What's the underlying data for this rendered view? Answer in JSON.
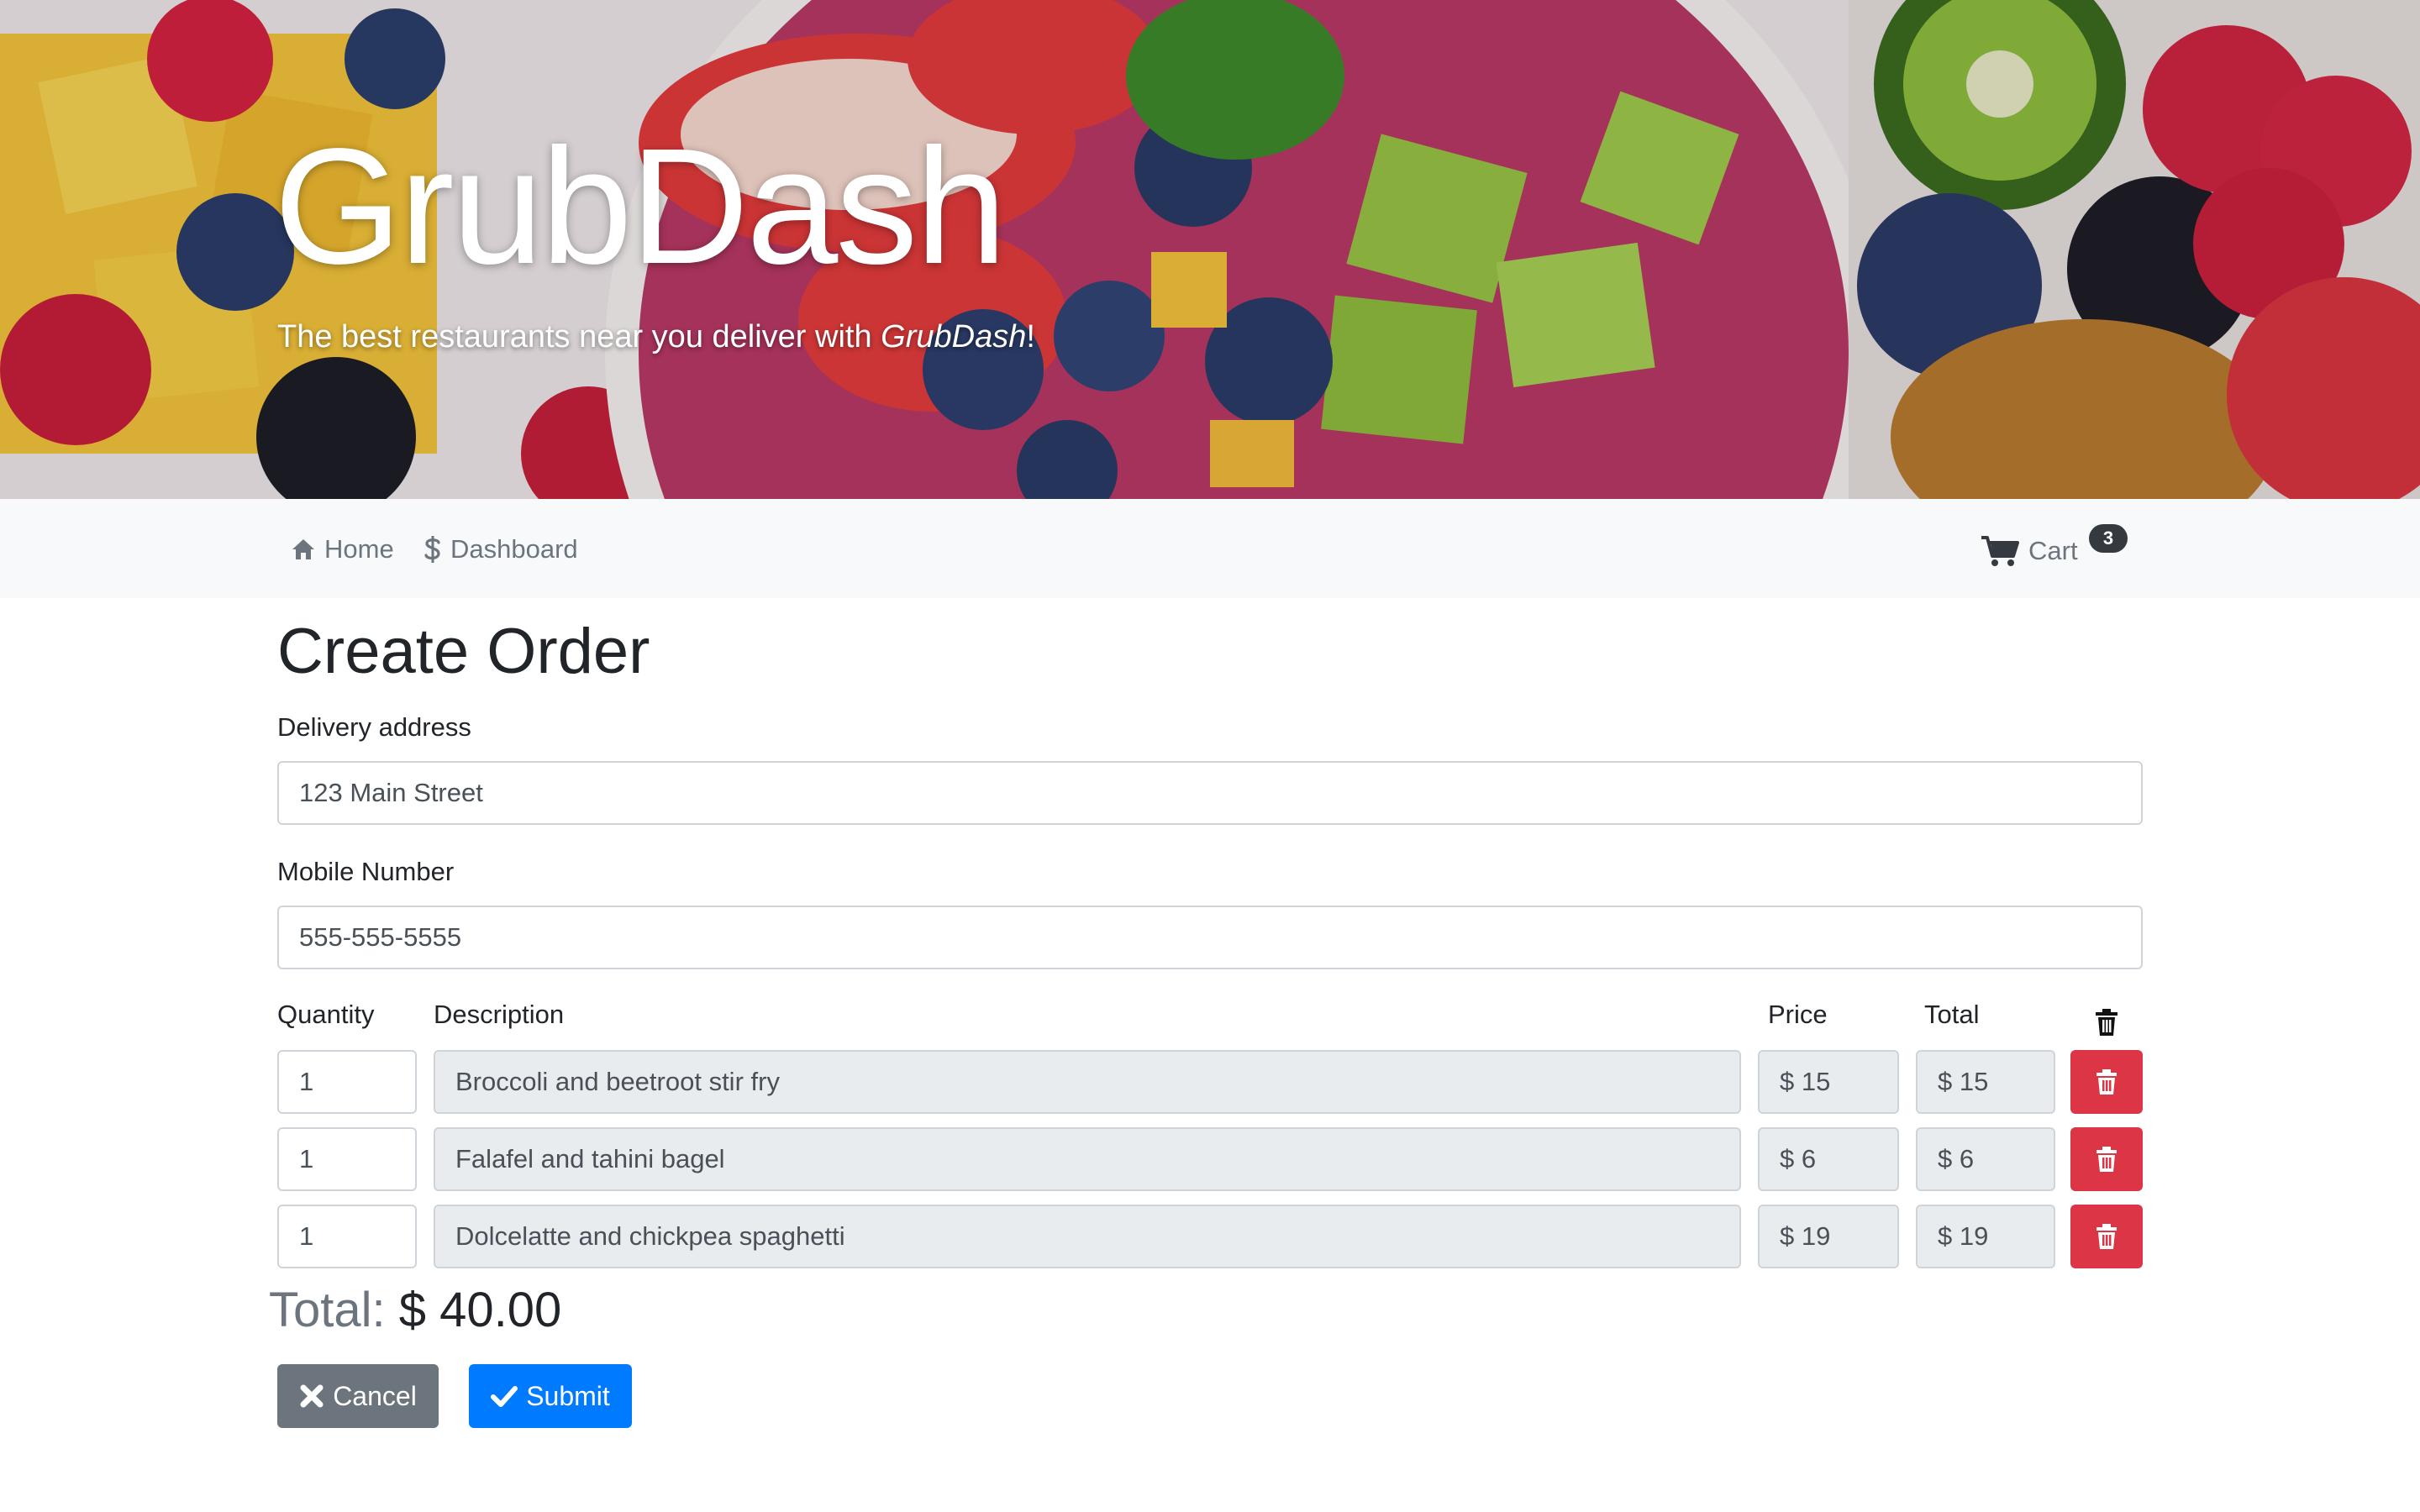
{
  "hero": {
    "title": "GrubDash",
    "subtitle_prefix": "The best restaurants near you deliver with ",
    "subtitle_brand": "GrubDash",
    "subtitle_suffix": "!"
  },
  "nav": {
    "home_label": "Home",
    "dashboard_label": "Dashboard",
    "cart_label": "Cart",
    "cart_count": "3"
  },
  "form": {
    "title": "Create Order",
    "address_label": "Delivery address",
    "address_value": "123 Main Street",
    "mobile_label": "Mobile Number",
    "mobile_value": "555-555-5555",
    "columns": {
      "quantity": "Quantity",
      "description": "Description",
      "price": "Price",
      "total": "Total"
    },
    "items": [
      {
        "quantity": "1",
        "description": "Broccoli and beetroot stir fry",
        "price": "$ 15",
        "total": "$ 15"
      },
      {
        "quantity": "1",
        "description": "Falafel and tahini bagel",
        "price": "$ 6",
        "total": "$ 6"
      },
      {
        "quantity": "1",
        "description": "Dolcelatte and chickpea spaghetti",
        "price": "$ 19",
        "total": "$ 19"
      }
    ],
    "order_total_label": "Total:",
    "order_total_value": "$ 40.00",
    "cancel_label": "Cancel",
    "submit_label": "Submit"
  },
  "colors": {
    "primary": "#007bff",
    "secondary": "#6c757d",
    "danger": "#dc3545",
    "navbar_bg": "#f8f9fa",
    "badge": "#343a40"
  },
  "icons": {
    "home": "home-icon",
    "dashboard": "dollar-icon",
    "cart": "cart-icon",
    "delete": "trash-icon",
    "cancel": "x-icon",
    "submit": "check-icon"
  }
}
